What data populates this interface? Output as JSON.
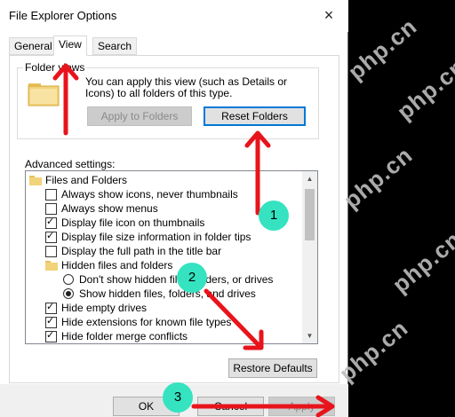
{
  "dialog": {
    "title": "File Explorer Options",
    "close_label": "×"
  },
  "tabs": [
    {
      "label": "General"
    },
    {
      "label": "View"
    },
    {
      "label": "Search"
    }
  ],
  "folder_views": {
    "title": "Folder views",
    "description": "You can apply this view (such as Details or Icons) to all folders of this type.",
    "apply_label": "Apply to Folders",
    "reset_label": "Reset Folders"
  },
  "advanced": {
    "label": "Advanced settings:",
    "items": [
      {
        "kind": "folder",
        "label": "Files and Folders"
      },
      {
        "kind": "checkbox",
        "checked": false,
        "label": "Always show icons, never thumbnails"
      },
      {
        "kind": "checkbox",
        "checked": false,
        "label": "Always show menus"
      },
      {
        "kind": "checkbox",
        "checked": true,
        "label": "Display file icon on thumbnails"
      },
      {
        "kind": "checkbox",
        "checked": true,
        "label": "Display file size information in folder tips"
      },
      {
        "kind": "checkbox",
        "checked": false,
        "label": "Display the full path in the title bar"
      },
      {
        "kind": "folder",
        "label": "Hidden files and folders"
      },
      {
        "kind": "radio",
        "checked": false,
        "label": "Don't show hidden files, folders, or drives"
      },
      {
        "kind": "radio",
        "checked": true,
        "label": "Show hidden files, folders, and drives"
      },
      {
        "kind": "checkbox",
        "checked": true,
        "label": "Hide empty drives"
      },
      {
        "kind": "checkbox",
        "checked": true,
        "label": "Hide extensions for known file types"
      },
      {
        "kind": "checkbox",
        "checked": true,
        "label": "Hide folder merge conflicts"
      }
    ],
    "restore_label": "Restore Defaults"
  },
  "footer": {
    "ok_label": "OK",
    "cancel_label": "Cancel",
    "apply_label": "Apply"
  },
  "annotations": {
    "badges": [
      "1",
      "2",
      "3"
    ],
    "arrow_color": "#e8141b",
    "badge_color": "#35e3c1"
  },
  "watermark": "php.cn"
}
